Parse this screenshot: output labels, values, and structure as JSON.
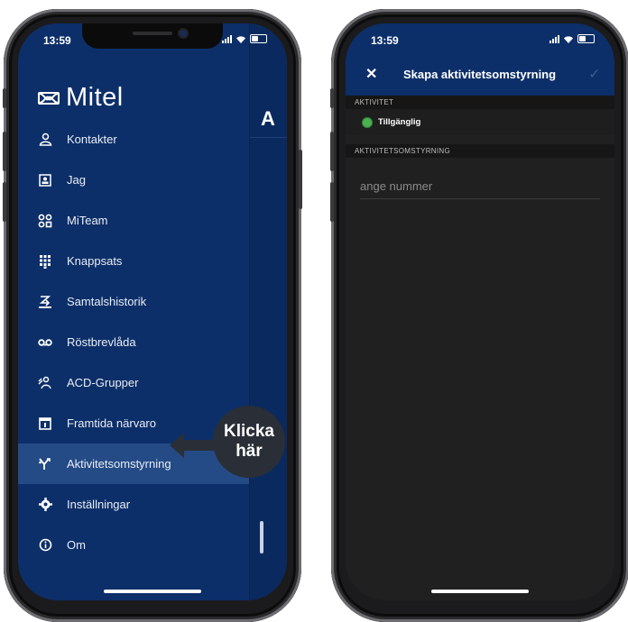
{
  "left_phone": {
    "status": {
      "time": "13:59"
    },
    "brand": {
      "name": "Mitel",
      "logo_icon": "mitel-logo-icon"
    },
    "peek_title": "A",
    "menu": [
      {
        "label": "Kontakter",
        "icon": "contacts-icon"
      },
      {
        "label": "Jag",
        "icon": "profile-card-icon"
      },
      {
        "label": "MiTeam",
        "icon": "team-icon"
      },
      {
        "label": "Knappsats",
        "icon": "keypad-icon"
      },
      {
        "label": "Samtalshistorik",
        "icon": "call-history-icon"
      },
      {
        "label": "Röstbrevlåda",
        "icon": "voicemail-icon"
      },
      {
        "label": "ACD-Grupper",
        "icon": "acd-groups-icon"
      },
      {
        "label": "Framtida närvaro",
        "icon": "calendar-icon"
      },
      {
        "label": "Aktivitetsomstyrning",
        "icon": "forward-icon",
        "active": true
      },
      {
        "label": "Inställningar",
        "icon": "gear-icon"
      },
      {
        "label": "Om",
        "icon": "info-icon"
      }
    ],
    "callout": {
      "line1": "Klicka",
      "line2": "här"
    }
  },
  "right_phone": {
    "status": {
      "time": "13:59"
    },
    "header": {
      "title": "Skapa aktivitetsomstyrning"
    },
    "section_activity": "AKTIVITET",
    "activity": {
      "label": "Tillgänglig",
      "status_color": "#4caf50"
    },
    "section_forwarding": "AKTIVITETSOMSTYRNING",
    "number_input": {
      "placeholder": "ange nummer",
      "value": ""
    }
  },
  "colors": {
    "brand_blue": "#0d2f69",
    "active_row": "#244b86",
    "dark_bg": "#202020"
  }
}
